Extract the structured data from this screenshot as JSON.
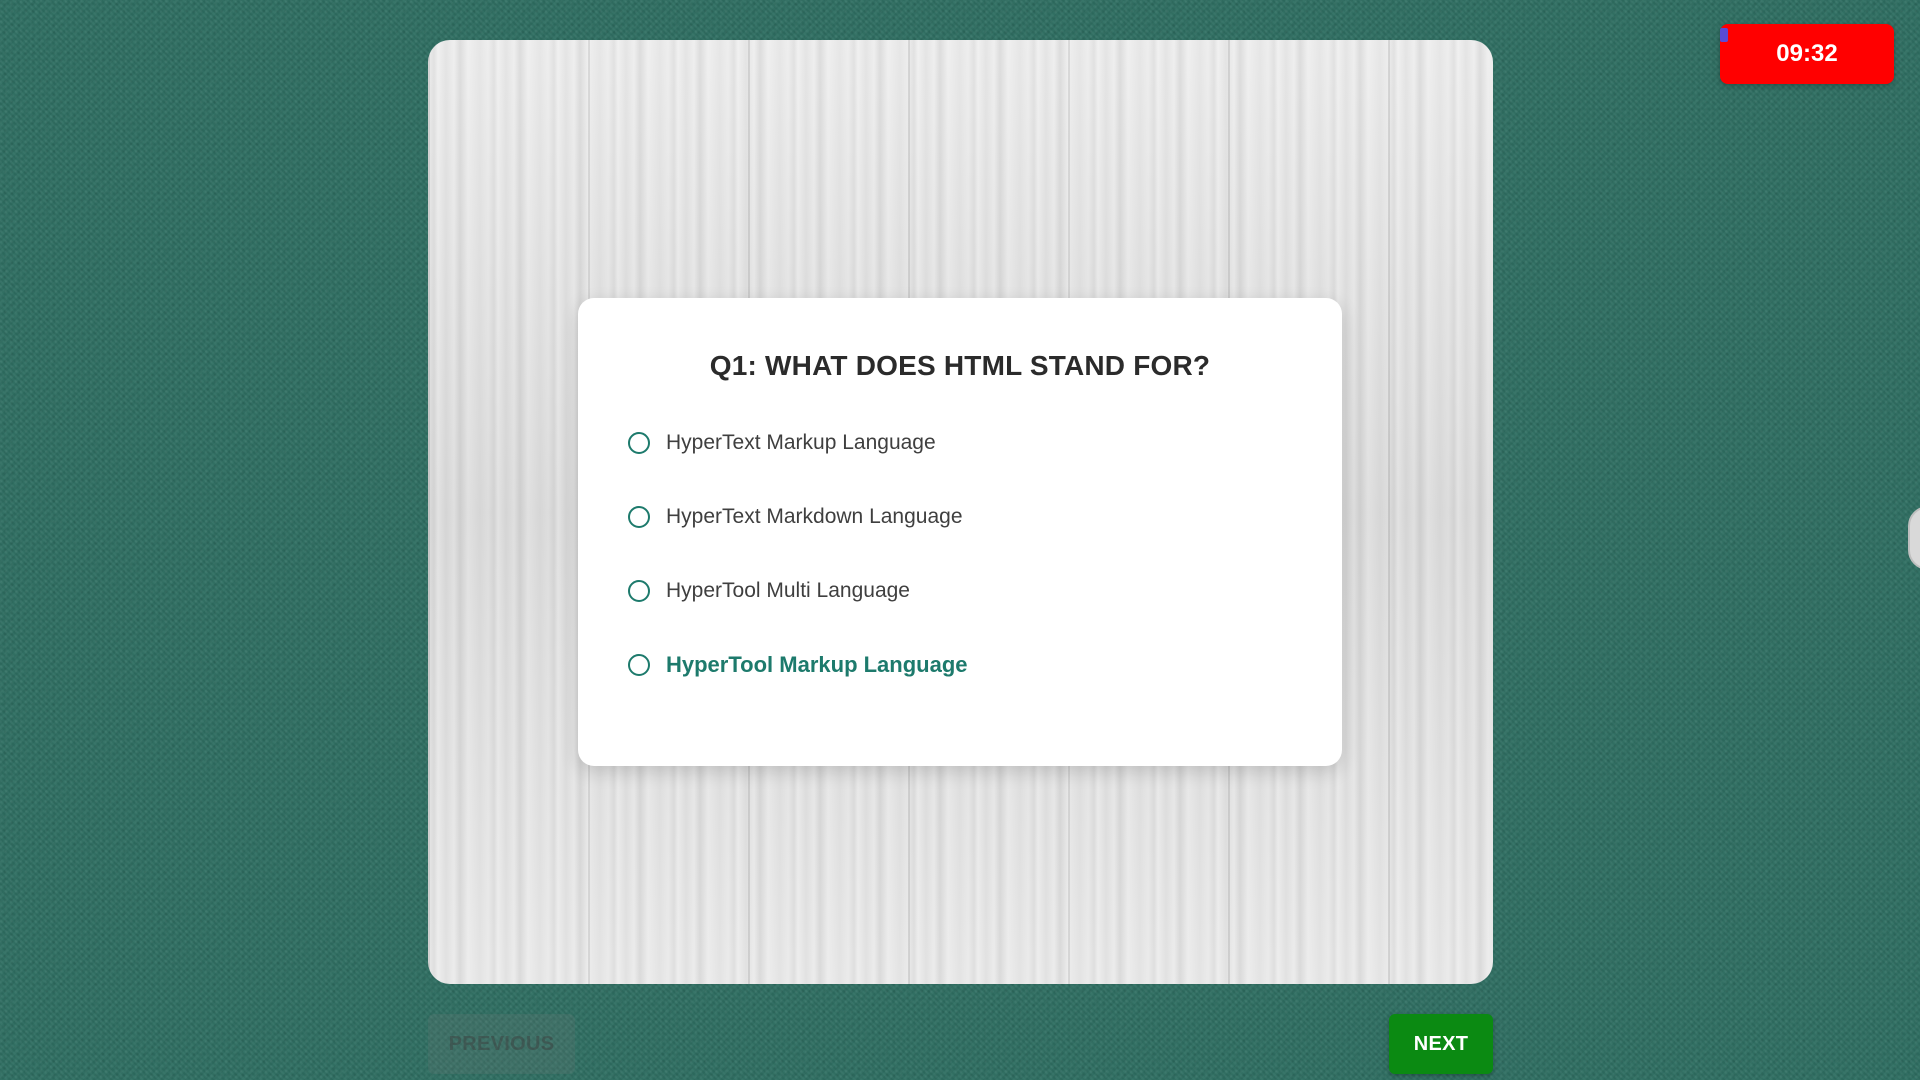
{
  "quiz": {
    "question": "Q1: WHAT DOES HTML STAND FOR?",
    "options": [
      {
        "label": "HyperText Markup Language"
      },
      {
        "label": "HyperText Markdown Language"
      },
      {
        "label": "HyperTool Multi Language"
      },
      {
        "label": "HyperTool Markup Language"
      }
    ],
    "hovered_option_index": 3
  },
  "timer": {
    "value": "09:32"
  },
  "navigation": {
    "previous_label": "PREVIOUS",
    "next_label": "NEXT"
  },
  "colors": {
    "background": "#2f6f62",
    "accent": "#1d7a6c",
    "timer": "#ff0000",
    "next_button": "#0b8a12"
  }
}
